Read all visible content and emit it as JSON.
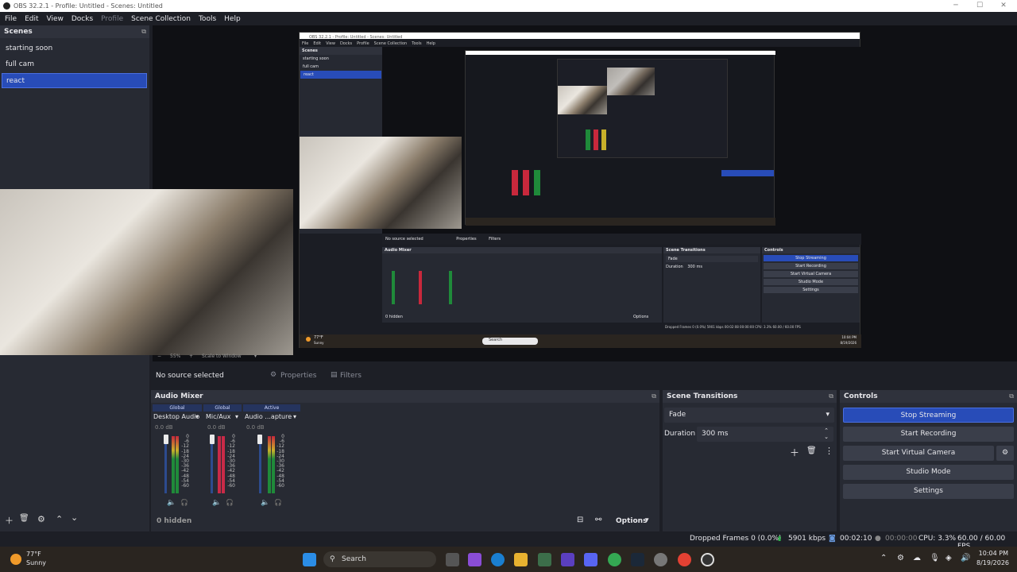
{
  "window": {
    "title": "OBS 32.2.1 - Profile: Untitled - Scenes: Untitled"
  },
  "menu": {
    "items": [
      "File",
      "Edit",
      "View",
      "Docks",
      "Profile",
      "Scene Collection",
      "Tools",
      "Help"
    ]
  },
  "scenes": {
    "title": "Scenes",
    "items": [
      "starting soon",
      "full cam",
      "react"
    ],
    "selected": "react"
  },
  "preview": {
    "nested": {
      "title": "OBS 32.2.1 - Profile: Untitled - Scenes: Untitled",
      "menu": [
        "File",
        "Edit",
        "View",
        "Docks",
        "Profile",
        "Scene Collection",
        "Tools",
        "Help"
      ],
      "scenes_title": "Scenes",
      "scenes": [
        "starting soon",
        "full cam",
        "react"
      ],
      "no_source": "No source selected",
      "properties": "Properties",
      "filters": "Filters",
      "audio_mixer": "Audio Mixer",
      "scene_transitions": "Scene Transitions",
      "controls": "Controls",
      "fade": "Fade",
      "duration_label": "Duration",
      "duration_value": "300 ms",
      "buttons": [
        "Stop Streaming",
        "Start Recording",
        "Start Virtual Camera",
        "Studio Mode",
        "Settings"
      ],
      "hidden": "0 hidden",
      "options": "Options",
      "status": "Dropped Frames 0 (0.0%)   5901 kbps   00:02:08   00:00:00   CPU: 3.3%   60.00 / 60.00 FPS",
      "weather": "77°F",
      "weather_sub": "Sunny",
      "search": "Search",
      "time": "10:04 PM",
      "date": "8/19/2026"
    },
    "zoom_controls": {
      "minus": "−",
      "zoom": "55%",
      "plus": "+",
      "scale": "Scale to Window"
    }
  },
  "source_bar": {
    "no_source": "No source selected",
    "properties": "Properties",
    "filters": "Filters"
  },
  "audio_mixer": {
    "title": "Audio Mixer",
    "channels": [
      {
        "scope": "Global",
        "name": "Desktop Audio",
        "db": "0.0 dB",
        "active": false
      },
      {
        "scope": "Global",
        "name": "Mic/Aux",
        "db": "0.0 dB",
        "active": false
      },
      {
        "scope": "Active",
        "name": "Audio ...apture",
        "db": "0.0 dB",
        "active": true
      }
    ],
    "ticks": [
      "0",
      "-6",
      "-12",
      "-18",
      "-24",
      "-30",
      "-36",
      "-42",
      "-48",
      "-54",
      "-60"
    ],
    "hidden_count": "0 hidden",
    "options_label": "Options"
  },
  "transitions": {
    "title": "Scene Transitions",
    "selected": "Fade",
    "duration_label": "Duration",
    "duration_value": "300 ms"
  },
  "controls": {
    "title": "Controls",
    "stop_streaming": "Stop Streaming",
    "start_recording": "Start Recording",
    "start_virtual_camera": "Start Virtual Camera",
    "studio_mode": "Studio Mode",
    "settings": "Settings"
  },
  "status": {
    "dropped": "Dropped Frames 0 (0.0%)",
    "bitrate": "5901 kbps",
    "stream_time": "00:02:10",
    "rec_time": "00:00:00",
    "cpu": "CPU: 3.3%",
    "fps": "60.00 / 60.00 FPS"
  },
  "taskbar": {
    "temp": "77°F",
    "weather": "Sunny",
    "search_placeholder": "Search",
    "time": "10:04 PM",
    "date": "8/19/2026"
  },
  "colors": {
    "accent": "#284cb8",
    "bg": "#1d1f26",
    "panel": "#272a33"
  }
}
